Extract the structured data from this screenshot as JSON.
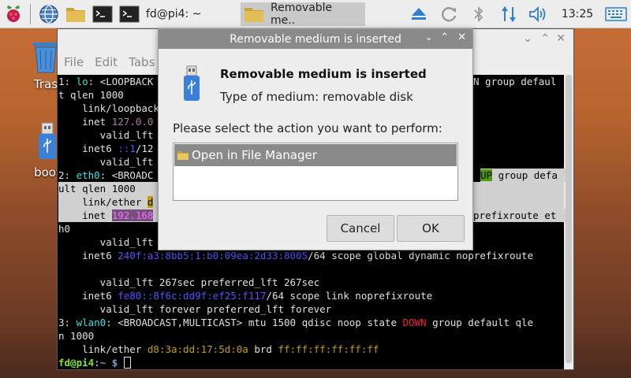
{
  "taskbar": {
    "tasks": [
      {
        "label": "fd@pi4: ~"
      },
      {
        "label": "Removable me.."
      }
    ],
    "clock": "13:25"
  },
  "desktop": {
    "trash_label": "Tras",
    "usb_label": "boot"
  },
  "terminal": {
    "menu": [
      "File",
      "Edit",
      "Tabs"
    ],
    "lines": [
      "1: lo: <LOOPBACK",
      "t qlen 1000",
      "    link/loopback",
      "    inet 127.0.0",
      "       valid_lft",
      "    inet6 ::1/12",
      "       valid_lft",
      "2: eth0: <BROADC",
      "ult qlen 1000",
      "    link/ether d",
      "    inet 192.168",
      "h0",
      "       valid_lft",
      "    inet6 240f:a3:8bb5:1:b0:09ea:2d33:8005/64 scope global dynamic noprefixroute",
      "",
      "       valid_lft 267sec preferred_lft 267sec",
      "    inet6 fe80::8f6c:dd9f:ef25:f117/64 scope link noprefixroute",
      "       valid_lft forever preferred_lft forever",
      "3: wlan0: <BROADCAST,MULTICAST> mtu 1500 qdisc noop state DOWN group default qle",
      "n 1000",
      "    link/ether d8:3a:dd:17:5d:0a brd ff:ff:ff:ff:ff:ff",
      "fd@pi4:~ $ "
    ],
    "tail_lo": "N group defaul",
    "tail_eth0_state": "UP",
    "tail_eth0": " group defa",
    "tail_inet": "prefixroute et"
  },
  "dialog": {
    "title": "Removable medium is inserted",
    "heading": "Removable medium is inserted",
    "type_label": "Type of medium:",
    "type_value": "removable disk",
    "prompt": "Please select the action you want to perform:",
    "actions": [
      {
        "label": "Open in File Manager"
      }
    ],
    "cancel_label": "Cancel",
    "ok_label": "OK"
  }
}
